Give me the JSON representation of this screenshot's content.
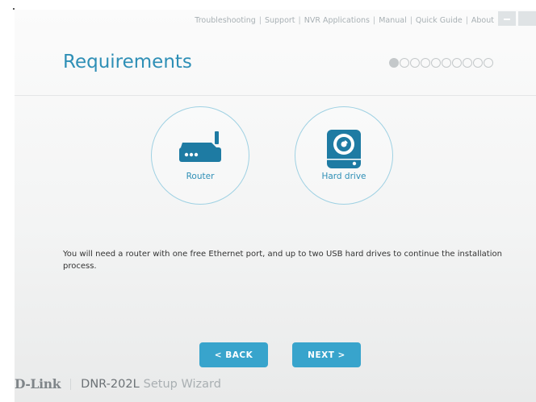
{
  "nav": {
    "links": [
      "Troubleshooting",
      "Support",
      "NVR Applications",
      "Manual",
      "Quick Guide",
      "About"
    ],
    "separator": "|"
  },
  "page": {
    "title": "Requirements"
  },
  "steps": {
    "total": 10,
    "current": 1
  },
  "requirements": [
    {
      "label": "Router",
      "icon": "router-icon"
    },
    {
      "label": "Hard drive",
      "icon": "hard-drive-icon"
    }
  ],
  "description": "You will need a router with one free Ethernet port, and up to two USB hard drives to continue the installation process.",
  "buttons": {
    "back": "< BACK",
    "next": "NEXT >"
  },
  "footer": {
    "brand": "D-Link",
    "product": "DNR-202L",
    "subtitle": "Setup Wizard"
  },
  "colors": {
    "accent": "#2e8fb6",
    "button": "#38a4cc",
    "icon": "#1e7ba3",
    "circle_border": "#9fd1e3",
    "nav_text": "#a8b0b4",
    "body_text": "#333333"
  }
}
